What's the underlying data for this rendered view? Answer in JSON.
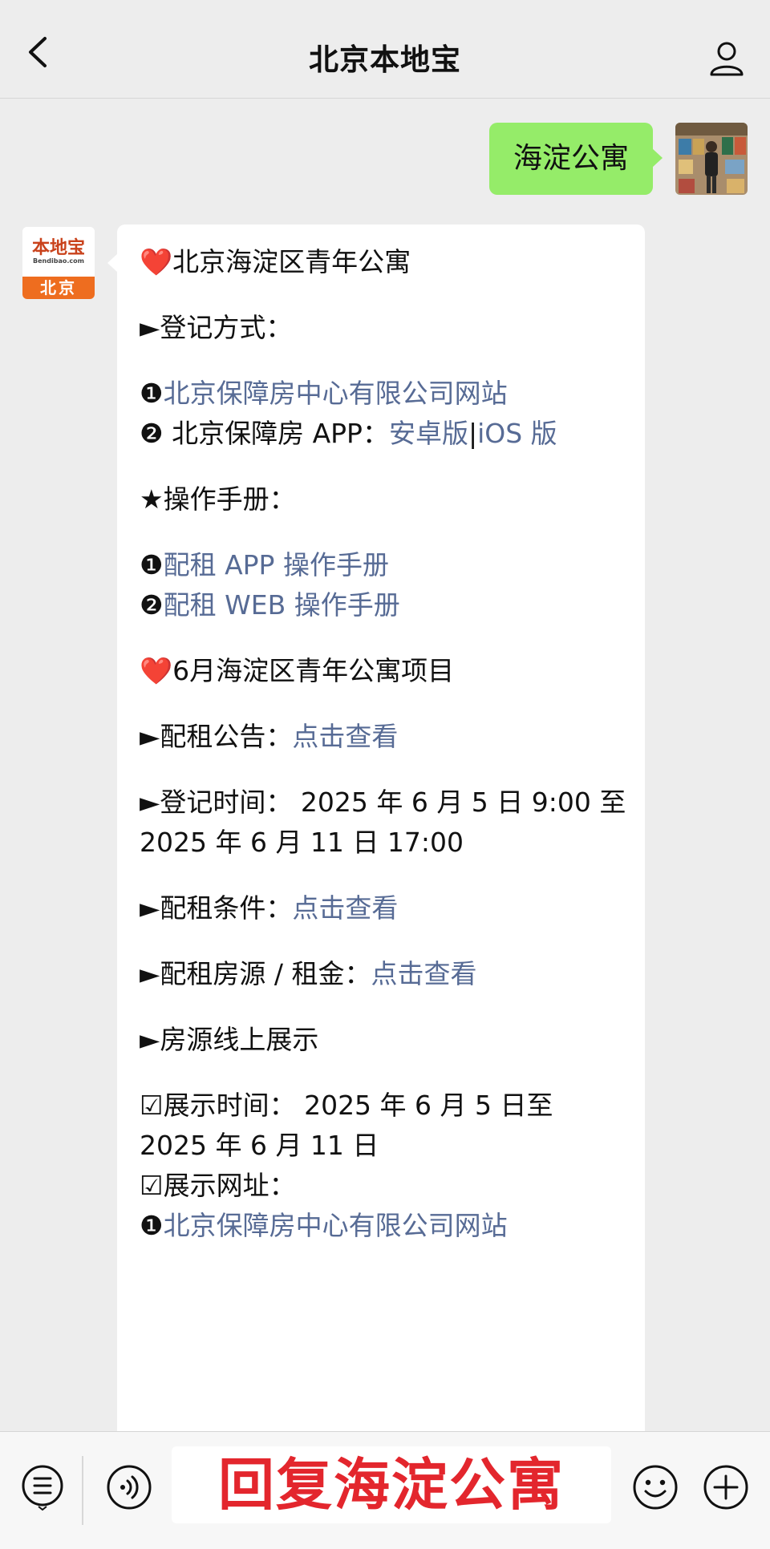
{
  "header": {
    "title": "北京本地宝",
    "back_icon": "chevron-left-icon",
    "profile_icon": "person-icon"
  },
  "outgoing": {
    "text": "海淀公寓",
    "bubble_color": "#95ec69"
  },
  "bot": {
    "avatar_cn": "本地宝",
    "avatar_en": "Bendibao.com",
    "avatar_city": "北京"
  },
  "message": {
    "title": "北京海淀区青年公寓",
    "reg_method_label": "►登记方式：",
    "reg_item1_bullet": "❶",
    "reg_item1_link": "北京保障房中心有限公司网站",
    "reg_item2_bullet": "❷",
    "reg_item2_text": "北京保障房 APP：",
    "reg_item2_link_a": "安卓版",
    "reg_item2_sep": "|",
    "reg_item2_link_b": "iOS 版",
    "manual_label": "★操作手册：",
    "manual_item1_bullet": "❶",
    "manual_item1_link": "配租 APP 操作手册",
    "manual_item2_bullet": "❷",
    "manual_item2_link": "配租 WEB 操作手册",
    "project_title": "6月海淀区青年公寓项目",
    "notice_label": "►配租公告：",
    "notice_link": "点击查看",
    "reg_time_line1": "►登记时间： 2025 年 6 月 5 日 9:00 至",
    "reg_time_line2": "2025 年 6 月 11 日 17:00",
    "cond_label": "►配租条件：",
    "cond_link": "点击查看",
    "rent_label": "►配租房源 / 租金：",
    "rent_link": "点击查看",
    "online_label": "►房源线上展示",
    "show_time_line1": "☑展示时间： 2025 年 6 月 5 日至",
    "show_time_line2": "2025 年 6 月 11 日",
    "show_url_label": "☑展示网址：",
    "show_url_bullet": "❶",
    "show_url_link": "北京保障房中心有限公司网站",
    "heart": "❤️",
    "link_color": "#576b95"
  },
  "input_bar": {
    "menu_icon": "menu-list-icon",
    "voice_icon": "voice-icon",
    "reply_text": "回复海淀公寓",
    "reply_color": "#e3262d",
    "emoji_icon": "emoji-icon",
    "plus_icon": "plus-icon"
  }
}
